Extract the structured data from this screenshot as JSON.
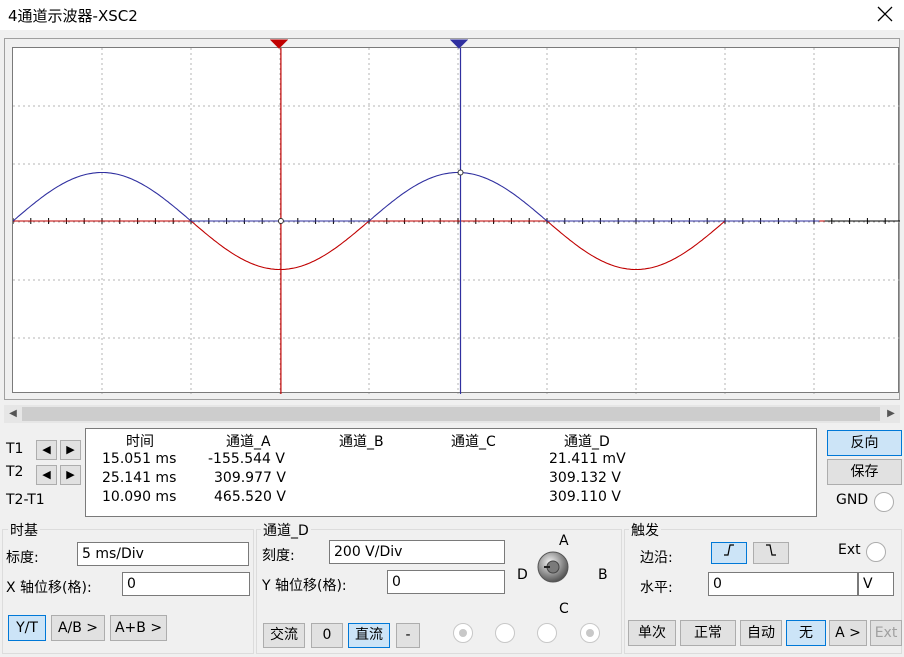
{
  "window": {
    "title": "4通道示波器-XSC2"
  },
  "colors": {
    "channel_a": "#c00000",
    "channel_d": "#3030a0",
    "cursor_t1": "#c00000",
    "cursor_t2": "#3030a0",
    "active_button": "#cce4f7"
  },
  "readout": {
    "headers": [
      "时间",
      "通道_A",
      "通道_B",
      "通道_C",
      "通道_D"
    ],
    "rows": [
      {
        "label": "T1",
        "time": "15.051 ms",
        "a": "-155.544 V",
        "b": "",
        "c": "",
        "d": "21.411 mV"
      },
      {
        "label": "T2",
        "time": "25.141 ms",
        "a": "309.977 V",
        "b": "",
        "c": "",
        "d": "309.132 V"
      },
      {
        "label": "T2-T1",
        "time": "10.090 ms",
        "a": "465.520 V",
        "b": "",
        "c": "",
        "d": "309.110 V"
      }
    ]
  },
  "right_buttons": {
    "reverse": "反向",
    "save": "保存",
    "gnd": "GND"
  },
  "timebase": {
    "title": "时基",
    "scale_label": "标度:",
    "scale_value": "5 ms/Div",
    "xpos_label": "X 轴位移(格):",
    "xpos_value": "0",
    "modes": [
      "Y/T",
      "A/B >",
      "A+B >"
    ]
  },
  "channel": {
    "title": "通道_D",
    "scale_label": "刻度:",
    "scale_value": "200  V/Div",
    "ypos_label": "Y 轴位移(格):",
    "ypos_value": "0",
    "coupling": [
      "交流",
      "0",
      "直流",
      "-"
    ],
    "knob_labels": {
      "a": "A",
      "b": "B",
      "c": "C",
      "d": "D"
    }
  },
  "trigger": {
    "title": "触发",
    "edge_label": "边沿:",
    "ext_label": "Ext",
    "level_label": "水平:",
    "level_value": "0",
    "level_unit": "V",
    "modes": [
      "单次",
      "正常",
      "自动",
      "无",
      "A >",
      "Ext"
    ]
  },
  "chart_data": {
    "type": "line",
    "x_unit": "ms",
    "x_range": [
      0,
      50
    ],
    "x_per_div": 5,
    "y_per_div": 200,
    "y_range": [
      -400,
      400
    ],
    "grid": true,
    "series": [
      {
        "name": "通道_A",
        "color": "#c00000",
        "x": [
          0,
          2.5,
          5,
          7.5,
          10,
          12.5,
          15,
          17.5,
          20,
          22.5,
          25,
          27.5,
          30,
          32.5,
          35,
          37.5,
          40,
          42.5,
          45
        ],
        "y": [
          0,
          0,
          0,
          0,
          0,
          -155.5,
          -220,
          -155.5,
          0,
          0,
          0,
          0,
          0,
          0,
          0,
          -155.5,
          -220,
          -155.5,
          -180
        ]
      },
      {
        "name": "通道_D",
        "color": "#3030a0",
        "x": [
          0,
          2.5,
          5,
          7.5,
          10,
          12.5,
          15,
          17.5,
          20,
          22.5,
          25,
          27.5,
          30,
          32.5,
          35,
          37.5,
          40,
          42.5,
          45
        ],
        "y": [
          0,
          155.5,
          220,
          155.5,
          0,
          0,
          0,
          0,
          0,
          155.5,
          220,
          155.5,
          0,
          0,
          0,
          0,
          0,
          0,
          0
        ]
      }
    ],
    "cursors": {
      "t1": 15.051,
      "t2": 25.141
    }
  }
}
